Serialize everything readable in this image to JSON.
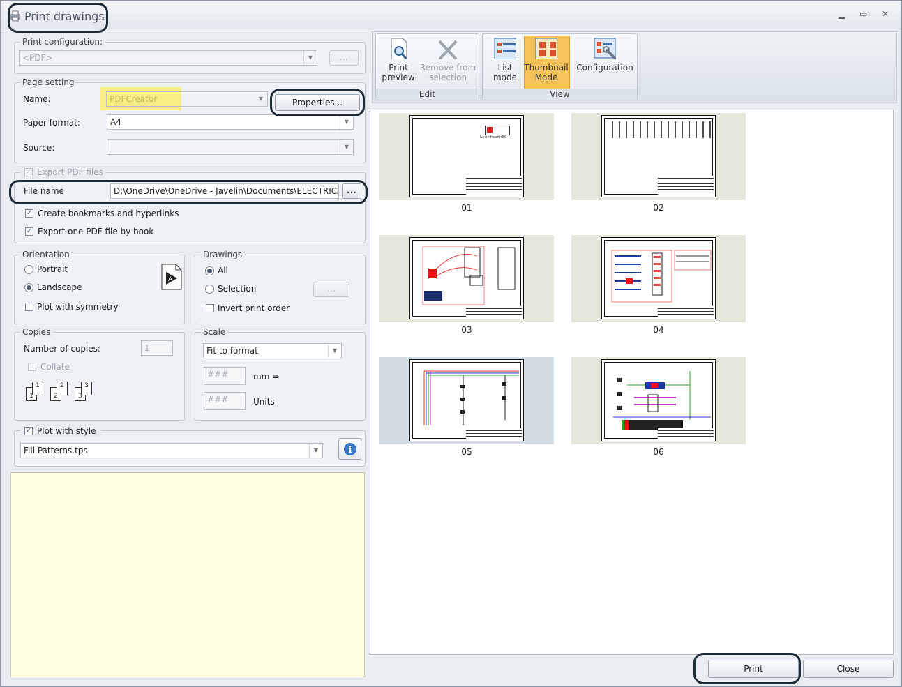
{
  "window": {
    "title": "Print drawings",
    "minimize": "▁",
    "maximize": "▭",
    "close": "✕"
  },
  "print_config": {
    "legend": "Print configuration:",
    "value": "<PDF>",
    "browse": "..."
  },
  "page_setting": {
    "legend": "Page setting",
    "name_label": "Name:",
    "name_value": "PDFCreator",
    "properties_label": "Properties...",
    "paper_label": "Paper format:",
    "paper_value": "A4",
    "source_label": "Source:",
    "source_value": ""
  },
  "export_pdf": {
    "legend": "Export PDF files",
    "file_label": "File name",
    "file_value": "D:\\OneDrive\\OneDrive - Javelin\\Documents\\ELECTRICAL",
    "browse": "...",
    "bookmarks_label": "Create bookmarks and hyperlinks",
    "one_file_label": "Export one PDF file by book"
  },
  "orientation": {
    "legend": "Orientation",
    "portrait": "Portrait",
    "landscape": "Landscape",
    "symmetry": "Plot with symmetry"
  },
  "drawings": {
    "legend": "Drawings",
    "all": "All",
    "selection": "Selection",
    "selection_btn": "...",
    "invert": "Invert print order"
  },
  "copies": {
    "legend": "Copies",
    "number_label": "Number of copies:",
    "number_value": "1",
    "collate": "Collate",
    "p1": "1",
    "p2": "2",
    "p3": "3"
  },
  "scale": {
    "legend": "Scale",
    "value": "Fit to format",
    "mm_value": "###",
    "mm_label": "mm =",
    "units_value": "###",
    "units_label": "Units"
  },
  "style": {
    "label": "Plot with style",
    "value": "Fill Patterns.tps",
    "info": "i"
  },
  "ribbon": {
    "edit_label": "Edit",
    "view_label": "View",
    "print_preview": [
      "Print",
      "preview"
    ],
    "remove_selection": [
      "Remove from",
      "selection"
    ],
    "list_mode": [
      "List",
      "mode"
    ],
    "thumbnail_mode": [
      "Thumbnail",
      "Mode"
    ],
    "configuration": "Configuration",
    "accent": "#f6c25a"
  },
  "thumbnails": [
    {
      "label": "01"
    },
    {
      "label": "02"
    },
    {
      "label": "03"
    },
    {
      "label": "04"
    },
    {
      "label": "05"
    },
    {
      "label": "06"
    }
  ],
  "sheet01_text": "Stoffmann06",
  "buttons": {
    "print": "Print",
    "close": "Close"
  },
  "colors": {
    "highlight_yellow": "#f7ee86",
    "notes_bg": "#ffffe0",
    "ring": "#1e2a38"
  }
}
